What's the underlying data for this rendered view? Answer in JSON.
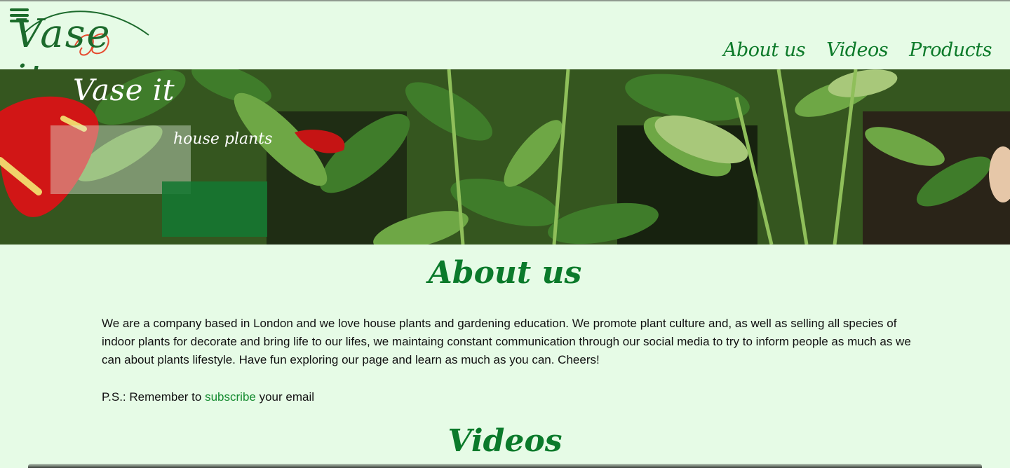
{
  "logo": {
    "text": "Vase it"
  },
  "nav": {
    "items": [
      {
        "label": "About us"
      },
      {
        "label": "Videos"
      },
      {
        "label": "Products"
      }
    ]
  },
  "hero": {
    "title": "Vase it",
    "subtitle": "house plants"
  },
  "about": {
    "heading": "About us",
    "body": "We are a company based in London and we love house plants and gardening education. We promote plant culture and, as well as selling all species of indoor plants for decorate and bring life to our lifes, we maintaing constant communication through our social media to try to inform people as much as we can about plants lifestyle. Have fun exploring our page and learn as much as you can. Cheers!",
    "ps_prefix": "P.S.: Remember to ",
    "ps_link": "subscribe",
    "ps_suffix": " your email"
  },
  "videos": {
    "heading": "Videos"
  },
  "colors": {
    "background": "#e6fbe6",
    "brand_green": "#0b7a2b",
    "accent_red": "#e64a2e"
  },
  "icons": {
    "menu": "hamburger-menu-icon"
  }
}
